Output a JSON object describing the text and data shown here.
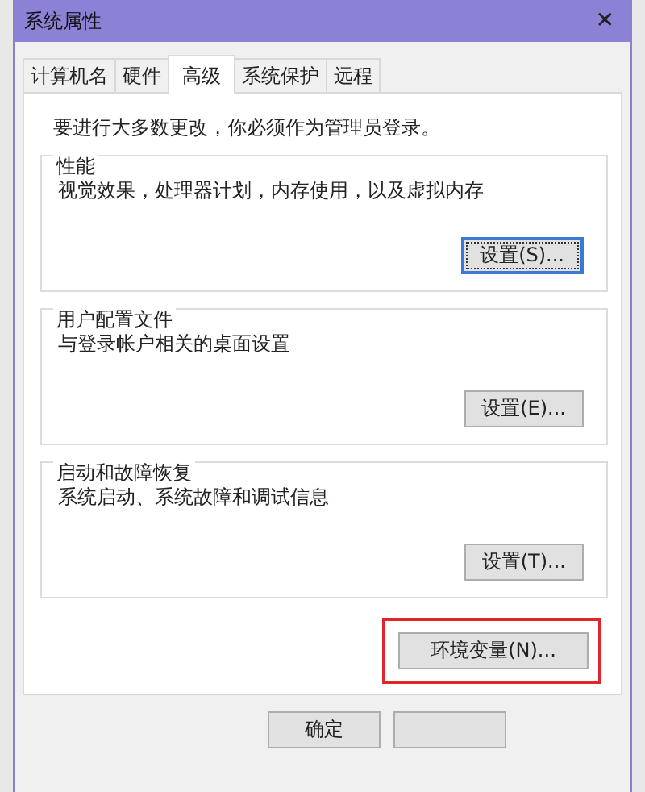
{
  "window": {
    "title": "系统属性",
    "close": "✕"
  },
  "tabs": [
    {
      "label": "计算机名",
      "selected": false
    },
    {
      "label": "硬件",
      "selected": false
    },
    {
      "label": "高级",
      "selected": true
    },
    {
      "label": "系统保护",
      "selected": false
    },
    {
      "label": "远程",
      "selected": false
    }
  ],
  "notice": "要进行大多数更改，你必须作为管理员登录。",
  "groups": [
    {
      "title": "性能",
      "description": "视觉效果，处理器计划，内存使用，以及虚拟内存",
      "button": {
        "label": "设置(S)...",
        "focused": true
      }
    },
    {
      "title": "用户配置文件",
      "description": "与登录帐户相关的桌面设置",
      "button": {
        "label": "设置(E)...",
        "focused": false
      }
    },
    {
      "title": "启动和故障恢复",
      "description": "系统启动、系统故障和调试信息",
      "button": {
        "label": "设置(T)...",
        "focused": false
      }
    }
  ],
  "environment_button": {
    "label": "环境变量(N)...",
    "highlighted": true
  },
  "footer_buttons": [
    {
      "kind": "labeled",
      "label": "确定"
    },
    {
      "kind": "covered"
    }
  ]
}
